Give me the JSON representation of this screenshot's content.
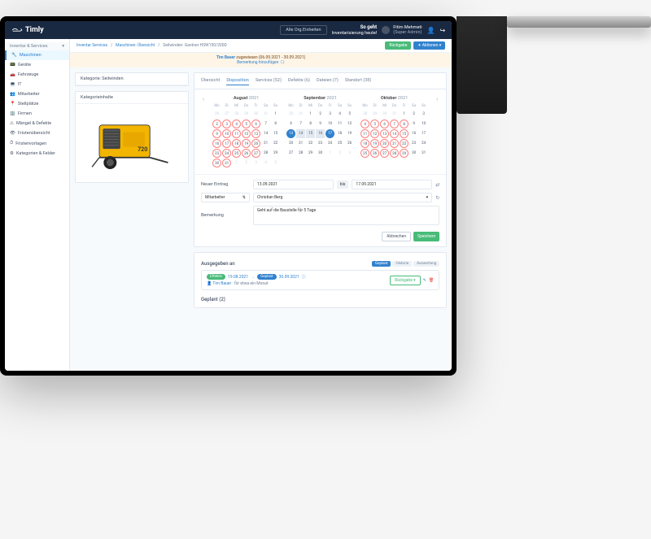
{
  "brand": "Timly",
  "topbar": {
    "org_button": "Alle Org.Einheiten",
    "slogan_line1": "So geht",
    "slogan_line2": "Inventarisierung heute!",
    "user_name": "Fitim Mehmeti",
    "user_role": "(Super Admin)"
  },
  "sidebar": {
    "header": "Inventar & Services",
    "items": [
      {
        "label": "Maschinen",
        "active": true
      },
      {
        "label": "Geräte"
      },
      {
        "label": "Fahrzeuge"
      },
      {
        "label": "IT"
      },
      {
        "label": "Mitarbeiter"
      },
      {
        "label": "Stellplätze"
      },
      {
        "label": "Firmen"
      },
      {
        "label": "Mängel & Defekte"
      },
      {
        "label": "Fristenübersicht"
      },
      {
        "label": "Fristenvorlagen"
      },
      {
        "label": "Kategorien & Felder"
      }
    ]
  },
  "breadcrumbs": {
    "a": "Inventar Services",
    "b": "Maschinen: Übersicht",
    "c": "Seilwinden: Gantner HSW150/200D",
    "return_btn": "Rückgabe",
    "actions_btn": "✦ Aktionen ▾"
  },
  "notice": {
    "text_prefix": "Tim Bauer",
    "text_suffix": " zugewiesen (06.09.2021 - 30.09.2021)",
    "link": "Bemerkung hinzufügen 🗨"
  },
  "left": {
    "category_label": "Kategorie: Seilwinden",
    "contents_label": "Kategorieinhalte"
  },
  "tabs": [
    {
      "label": "Übersicht"
    },
    {
      "label": "Disposition",
      "active": true
    },
    {
      "label": "Services (52)"
    },
    {
      "label": "Defekte (6)"
    },
    {
      "label": "Dateien (7)"
    },
    {
      "label": "Standort (38)"
    }
  ],
  "calendars": {
    "days": [
      "Mo",
      "Di",
      "Mi",
      "Do",
      "Fr",
      "Sa",
      "So"
    ],
    "months": [
      {
        "name": "August",
        "year": "2021",
        "lead": 6,
        "days": 31,
        "ring": [
          2,
          3,
          4,
          5,
          6,
          9,
          10,
          11,
          12,
          13,
          16,
          17,
          18,
          19,
          20,
          23,
          24,
          25,
          26,
          27,
          30,
          31
        ],
        "sel": [],
        "range": []
      },
      {
        "name": "September",
        "year": "2021",
        "lead": 2,
        "days": 30,
        "ring": [],
        "sel": [
          13,
          17
        ],
        "range": [
          14,
          15,
          16
        ]
      },
      {
        "name": "Oktober",
        "year": "2021",
        "lead": 4,
        "days": 31,
        "ring": [
          4,
          5,
          6,
          7,
          8,
          11,
          12,
          13,
          14,
          15,
          18,
          19,
          20,
          21,
          22,
          25,
          26,
          27,
          28,
          29
        ],
        "sel": [],
        "range": []
      }
    ]
  },
  "form": {
    "new_entry": "Neuer Eintrag",
    "date_from": "13.09.2021",
    "date_to_label": "bis",
    "date_to": "17.09.2021",
    "type_label": "Mitarbeiter",
    "person": "Christian Berg",
    "note_label": "Bemerkung",
    "note_value": "Geht auf die Baustelle für 5 Tage",
    "cancel": "Abbrechen",
    "save": "Speichern"
  },
  "assigned": {
    "title": "Ausgegeben an",
    "pills": [
      "Geplant",
      "Historie",
      "Auswertung"
    ],
    "badge1": "Effektiv",
    "date1": "19.08.2021",
    "badge2": "Geplant",
    "date2": "30.09.2021",
    "person": "Tim Bauer",
    "duration": "für etwa ein Monat",
    "return_btn": "Rückgabe ▾"
  },
  "planned_title": "Geplant (2)"
}
